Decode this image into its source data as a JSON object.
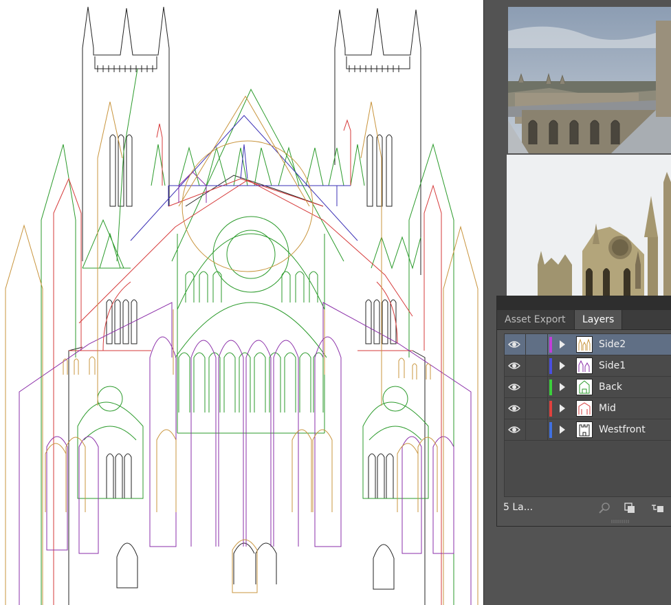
{
  "tabs": {
    "asset_export": "Asset Export",
    "layers": "Layers"
  },
  "layers": [
    {
      "name": "Side2",
      "color": "#c23ed8",
      "selected": true
    },
    {
      "name": "Side1",
      "color": "#4a4fe0",
      "selected": false
    },
    {
      "name": "Back",
      "color": "#3ccf3c",
      "selected": false
    },
    {
      "name": "Mid",
      "color": "#e0413e",
      "selected": false
    },
    {
      "name": "Westfront",
      "color": "#4070e0",
      "selected": false
    }
  ],
  "footer": {
    "layers_count": "5 La..."
  },
  "icons": {
    "visibility": "eye-icon",
    "expand": "triangle-right-icon",
    "locate": "magnifier-icon",
    "clipping": "clipping-mask-icon",
    "sublayer": "sublayer-icon"
  },
  "colors": {
    "panel_bg": "#535353",
    "selection": "#606f85",
    "workspace": "#3f3f3f"
  }
}
